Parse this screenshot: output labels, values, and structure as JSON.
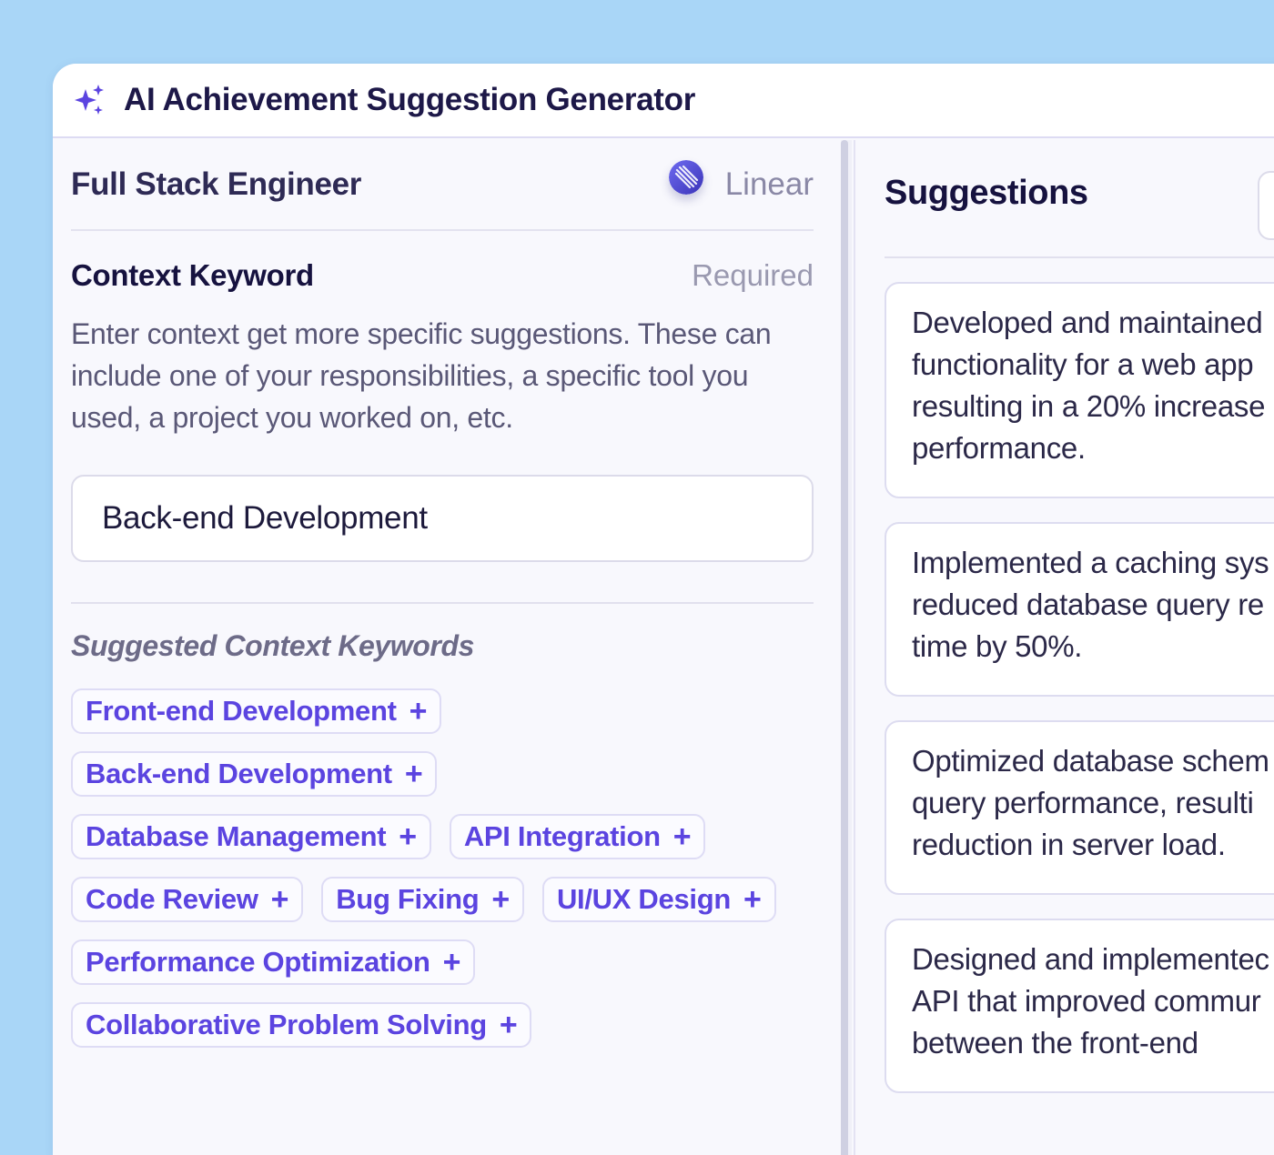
{
  "app": {
    "title": "AI Achievement Suggestion Generator",
    "title_icon": "sparkles-icon",
    "accent_color": "#5b44e0"
  },
  "job": {
    "role": "Full Stack Engineer",
    "company": "Linear",
    "company_logo": "linear-logo"
  },
  "context": {
    "title": "Context Keyword",
    "required_label": "Required",
    "description": "Enter context get more specific suggestions. These can include one of your responsibilities, a specific tool you used, a project you worked on, etc.",
    "input_value": "Back-end Development"
  },
  "suggested_keywords": {
    "title": "Suggested Context Keywords",
    "rows": [
      [
        "Front-end Development"
      ],
      [
        "Back-end Development"
      ],
      [
        "Database Management",
        "API Integration"
      ],
      [
        "Code Review",
        "Bug Fixing",
        "UI/UX Design"
      ],
      [
        "Performance Optimization"
      ],
      [
        "Collaborative Problem Solving"
      ]
    ],
    "add_symbol": "+"
  },
  "suggestions": {
    "title": "Suggestions",
    "cards": [
      [
        "Developed and maintained",
        "functionality for a web app",
        "resulting in a 20% increase",
        "performance."
      ],
      [
        "Implemented a caching sys",
        "reduced database query re",
        "time by 50%."
      ],
      [
        "Optimized database schem",
        "query performance, resulti",
        "reduction in server load."
      ],
      [
        "Designed and implementec",
        "API that improved commur",
        "between the front-end"
      ]
    ]
  }
}
